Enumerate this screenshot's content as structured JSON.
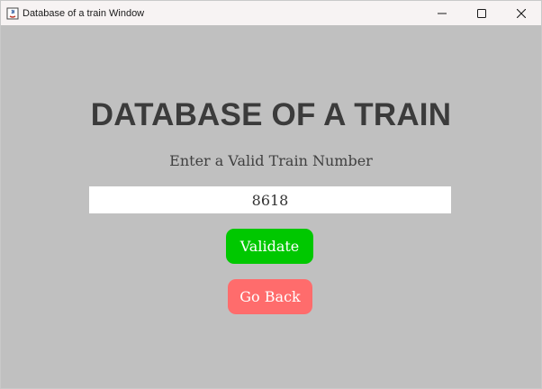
{
  "window": {
    "title": "Database of a train Window",
    "controls": {
      "minimize": "minimize-icon",
      "maximize": "maximize-icon",
      "close": "close-icon"
    }
  },
  "main": {
    "heading": "DATABASE OF A TRAIN",
    "prompt": "Enter a Valid Train Number",
    "train_number_input": {
      "value": "8618"
    },
    "validate_label": "Validate",
    "go_back_label": "Go Back"
  },
  "colors": {
    "background": "#c0c0c0",
    "validate_button": "#00c800",
    "go_back_button": "#ff6c6c",
    "heading_text": "#3b3b3b"
  }
}
